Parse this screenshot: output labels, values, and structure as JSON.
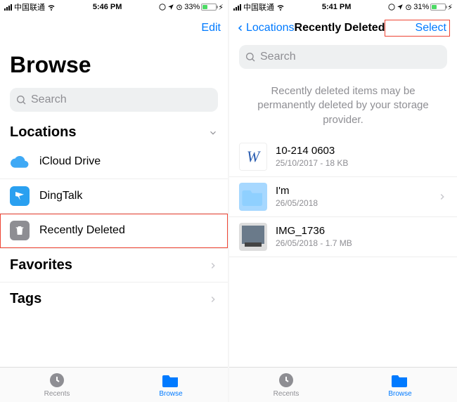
{
  "left": {
    "status": {
      "carrier": "中国联通",
      "time": "5:46 PM",
      "battery_pct": "33%"
    },
    "nav": {
      "edit": "Edit"
    },
    "title": "Browse",
    "search_placeholder": "Search",
    "sections": {
      "locations_label": "Locations",
      "icloud_label": "iCloud Drive",
      "dingtalk_label": "DingTalk",
      "recently_deleted_label": "Recently Deleted",
      "favorites_label": "Favorites",
      "tags_label": "Tags"
    },
    "tabs": {
      "recents": "Recents",
      "browse": "Browse"
    }
  },
  "right": {
    "status": {
      "carrier": "中国联通",
      "time": "5:41 PM",
      "battery_pct": "31%"
    },
    "nav": {
      "back": "Locations",
      "title": "Recently Deleted",
      "select": "Select"
    },
    "search_placeholder": "Search",
    "info": "Recently deleted items may be permanently deleted by your storage provider.",
    "files": {
      "f1": {
        "name": "10-214  0603",
        "meta": "25/10/2017 - 18 KB"
      },
      "f2": {
        "name": "I'm",
        "meta": "26/05/2018"
      },
      "f3": {
        "name": "IMG_1736",
        "meta": "26/05/2018 - 1.7 MB"
      }
    },
    "tabs": {
      "recents": "Recents",
      "browse": "Browse"
    }
  }
}
